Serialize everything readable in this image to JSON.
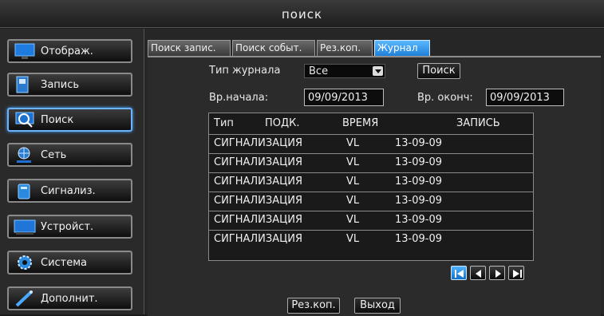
{
  "title": "поиск",
  "sidebar": {
    "items": [
      {
        "label": "Отображ.",
        "icon": "monitor-icon"
      },
      {
        "label": "Запись",
        "icon": "recorder-icon"
      },
      {
        "label": "Поиск",
        "icon": "search-icon",
        "active": true
      },
      {
        "label": "Сеть",
        "icon": "network-icon"
      },
      {
        "label": "Сигнализ.",
        "icon": "alarm-icon"
      },
      {
        "label": "Устройст.",
        "icon": "device-icon"
      },
      {
        "label": "Система",
        "icon": "gear-icon"
      },
      {
        "label": "Дополнит.",
        "icon": "tools-icon"
      }
    ]
  },
  "tabs": [
    {
      "label": "Поиск запис."
    },
    {
      "label": "Поиск событ."
    },
    {
      "label": "Рез.коп."
    },
    {
      "label": "Журнал",
      "active": true
    }
  ],
  "journal": {
    "type_label": "Тип журнала",
    "type_value": "Все",
    "search_button": "Поиск",
    "start_label": "Вр.начала:",
    "start_value": "09/09/2013",
    "end_label": "Вр. оконч:",
    "end_value": "09/09/2013"
  },
  "table": {
    "headers": [
      "Тип",
      "ПОДК.",
      "ВРЕМЯ",
      "ЗАПИСЬ"
    ],
    "rows": [
      [
        "СИГНАЛИЗАЦИЯ",
        "VL",
        "13-09-09"
      ],
      [
        "СИГНАЛИЗАЦИЯ",
        "VL",
        "13-09-09"
      ],
      [
        "СИГНАЛИЗАЦИЯ",
        "VL",
        "13-09-09"
      ],
      [
        "СИГНАЛИЗАЦИЯ",
        "VL",
        "13-09-09"
      ],
      [
        "СИГНАЛИЗАЦИЯ",
        "VL",
        "13-09-09"
      ],
      [
        "СИГНАЛИЗАЦИЯ",
        "VL",
        "13-09-09"
      ]
    ]
  },
  "pager": {
    "buttons": [
      "first-page-icon",
      "prev-page-icon",
      "next-page-icon",
      "last-page-icon"
    ]
  },
  "footer": {
    "backup_button": "Рез.коп.",
    "exit_button": "Выход"
  },
  "colors": {
    "accent": "#2f96ff",
    "background": "#2b2b2b",
    "text": "#f0f0f0"
  }
}
